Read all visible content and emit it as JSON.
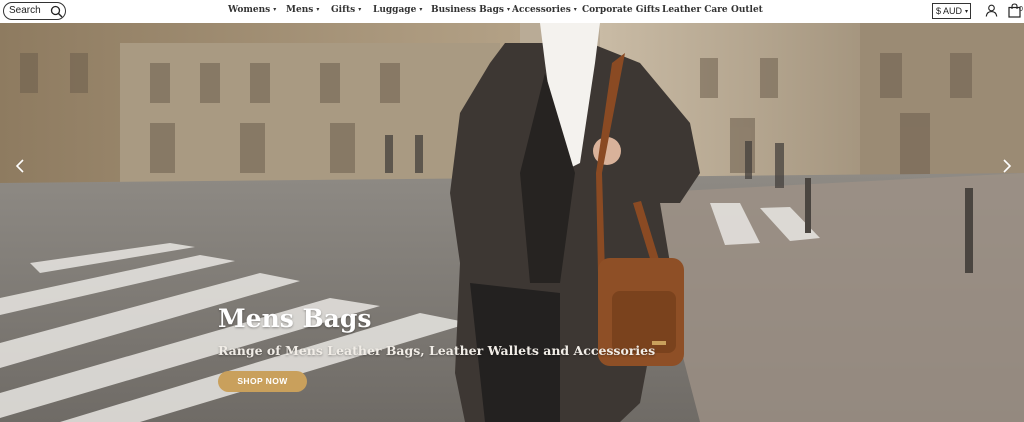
{
  "header": {
    "search": {
      "label": "Search"
    },
    "nav": [
      {
        "label": "Womens",
        "caret": "▾"
      },
      {
        "label": "Mens",
        "caret": "▾"
      },
      {
        "label": "Gifts",
        "caret": "▾"
      },
      {
        "label": "Luggage",
        "caret": "▾"
      },
      {
        "label": "Business Bags",
        "caret": "▾"
      },
      {
        "label": "Accessories",
        "caret": "▾"
      },
      {
        "label": "Corporate Gifts",
        "caret": ""
      },
      {
        "label": "Leather Care",
        "caret": ""
      },
      {
        "label": "Outlet",
        "caret": ""
      }
    ],
    "currency": {
      "label": "$ AUD",
      "caret": "▾"
    },
    "cart_count": "0"
  },
  "hero": {
    "title": "Mens Bags",
    "subtitle": "Range of Mens Leather Bags, Leather Wallets and Accessories",
    "button_label": "SHOP NOW",
    "button_color": "#c9a05c"
  },
  "icons": {
    "search": "search-icon",
    "user": "user-icon",
    "cart": "shopping-bag-icon",
    "prev": "chevron-left-icon",
    "next": "chevron-right-icon"
  }
}
